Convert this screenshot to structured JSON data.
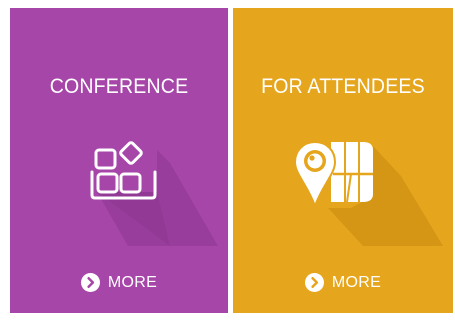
{
  "tiles": [
    {
      "title": "CONFERENCE",
      "icon": "apps-grid-icon",
      "more_label": "MORE",
      "color": "#a646a8"
    },
    {
      "title": "FOR ATTENDEES",
      "icon": "map-pin-icon",
      "more_label": "MORE",
      "color": "#e5a51c"
    }
  ]
}
